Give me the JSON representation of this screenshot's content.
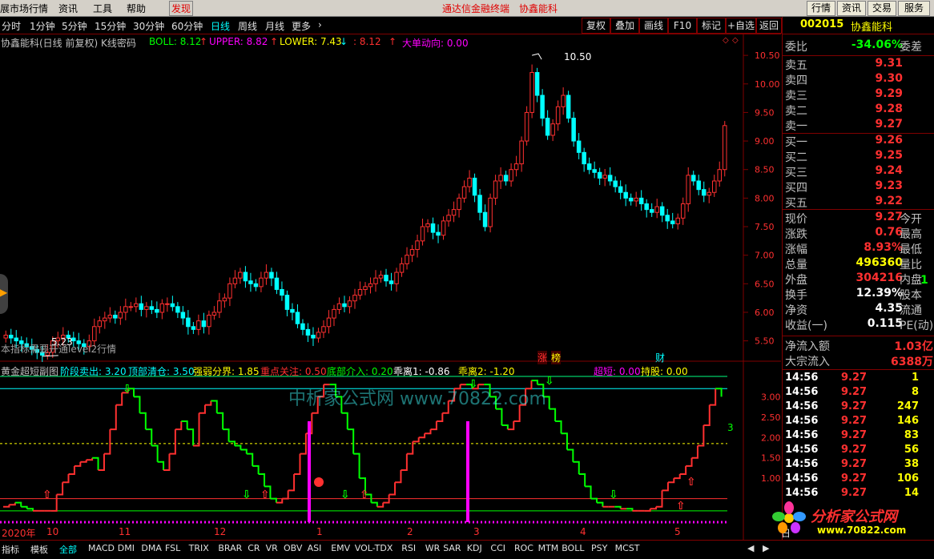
{
  "menu": {
    "items": [
      "展市场行情",
      "资讯",
      "工具",
      "帮助"
    ],
    "discover": "发现",
    "center_title": "通达信金融终端",
    "center_stock": "协鑫能科",
    "right_buttons": [
      "行情",
      "资讯",
      "交易",
      "服务"
    ]
  },
  "periods": [
    "分时",
    "1分钟",
    "5分钟",
    "15分钟",
    "30分钟",
    "60分钟",
    "日线",
    "周线",
    "月线",
    "更多"
  ],
  "active_period": "日线",
  "toolbar_buttons": [
    "复权",
    "叠加",
    "画线",
    "F10",
    "标记",
    "+自选",
    "返回"
  ],
  "main_legend": {
    "title": "协鑫能科(日线 前复权) K线密码",
    "boll": "BOLL: 8.12",
    "upper": "UPPER: 8.82",
    "lower": "LOWER: 7.43",
    "mid": ": 8.12",
    "dadan": "大单动向: 0.00"
  },
  "main_axis": [
    "10.50",
    "10.00",
    "9.50",
    "9.00",
    "8.50",
    "8.00",
    "7.50",
    "7.00",
    "6.50",
    "6.00",
    "5.50"
  ],
  "main_notes": {
    "high_label": "10.50",
    "low_label": "5.23",
    "level2_note": "本指标需要开通level2行情",
    "tag_zhang": "涨",
    "tag_bang": "榜",
    "tag_cai": "财"
  },
  "sub_legend": {
    "title": "黄金超短副图",
    "items": [
      {
        "text": "阶段卖出: 3.20",
        "color": "#00ffff"
      },
      {
        "text": "顶部清仓: 3.50",
        "color": "#00ffff"
      },
      {
        "text": "强弱分界: 1.85",
        "color": "#ffff00"
      },
      {
        "text": "重点关注: 0.50",
        "color": "#ff3030"
      },
      {
        "text": "底部介入: 0.20",
        "color": "#00ff00"
      },
      {
        "text": "乖离1: -0.86",
        "color": "#ffffff"
      },
      {
        "text": "乖离2: -1.20",
        "color": "#ffff00"
      },
      {
        "text": "超短: 0.00",
        "color": "#ff00ff"
      },
      {
        "text": "持股: 0.00",
        "color": "#ffff00"
      }
    ]
  },
  "sub_axis": [
    "3.00",
    "2.50",
    "2.00",
    "1.50",
    "1.00"
  ],
  "sub_value_label": "3",
  "watermark": "中析家公式网 www.70822.com",
  "x_axis": [
    "2020年",
    "10",
    "11",
    "12",
    "1",
    "2",
    "3",
    "4",
    "5"
  ],
  "quote": {
    "code": "002015",
    "name": "协鑫能科",
    "weibi_label": "委比",
    "weibi": "-34.06%",
    "weicha_label": "委差",
    "sell": [
      {
        "label": "卖五",
        "price": "9.31"
      },
      {
        "label": "卖四",
        "price": "9.30"
      },
      {
        "label": "卖三",
        "price": "9.29"
      },
      {
        "label": "卖二",
        "price": "9.28"
      },
      {
        "label": "卖一",
        "price": "9.27"
      }
    ],
    "buy": [
      {
        "label": "买一",
        "price": "9.26"
      },
      {
        "label": "买二",
        "price": "9.25"
      },
      {
        "label": "买三",
        "price": "9.24"
      },
      {
        "label": "买四",
        "price": "9.23"
      },
      {
        "label": "买五",
        "price": "9.22"
      }
    ],
    "stats": [
      {
        "label": "现价",
        "value": "9.27",
        "label2": "今开",
        "color": "#ff3030"
      },
      {
        "label": "涨跌",
        "value": "0.76",
        "label2": "最高",
        "color": "#ff3030"
      },
      {
        "label": "涨幅",
        "value": "8.93%",
        "label2": "最低",
        "color": "#ff3030"
      },
      {
        "label": "总量",
        "value": "496360",
        "label2": "量比",
        "color": "#ffff00"
      },
      {
        "label": "外盘",
        "value": "304216",
        "label2": "内盘",
        "color": "#ff3030"
      },
      {
        "label": "换手",
        "value": "12.39%",
        "label2": "股本",
        "color": "#ffffff"
      },
      {
        "label": "净资",
        "value": "4.35",
        "label2": "流通",
        "color": "#ffffff"
      },
      {
        "label": "收益(一)",
        "value": "0.115",
        "label2": "PE(动)",
        "color": "#ffffff"
      }
    ],
    "neipan_partial": "1",
    "net_inflow_label": "净流入额",
    "net_inflow": "1.03亿",
    "big_inflow_label": "大宗流入",
    "big_inflow": "6388万",
    "ticks": [
      {
        "time": "14:56",
        "price": "9.27",
        "vol": "1"
      },
      {
        "time": "14:56",
        "price": "9.27",
        "vol": "8"
      },
      {
        "time": "14:56",
        "price": "9.27",
        "vol": "247"
      },
      {
        "time": "14:56",
        "price": "9.27",
        "vol": "146"
      },
      {
        "time": "14:56",
        "price": "9.27",
        "vol": "83"
      },
      {
        "time": "14:56",
        "price": "9.27",
        "vol": "56"
      },
      {
        "time": "14:56",
        "price": "9.27",
        "vol": "38"
      },
      {
        "time": "14:56",
        "price": "9.27",
        "vol": "106"
      },
      {
        "time": "14:56",
        "price": "9.27",
        "vol": "14"
      }
    ],
    "day_tab": "日"
  },
  "bottom_tabs": [
    "指标",
    "模板",
    "全部",
    "MACD",
    "DMI",
    "DMA",
    "FSL",
    "TRIX",
    "BRAR",
    "CR",
    "VR",
    "OBV",
    "ASI",
    "EMV",
    "VOL-TDX",
    "RSI",
    "WR",
    "SAR",
    "KDJ",
    "CCI",
    "ROC",
    "MTM",
    "BOLL",
    "PSY",
    "MCST"
  ],
  "active_tab": "全部",
  "logo": {
    "line1": "分析家公式网",
    "line2": "www.70822.com"
  },
  "chart_data": {
    "type": "candlestick",
    "ylim": [
      5.2,
      10.6
    ],
    "high_marker": 10.5,
    "low_marker": 5.23,
    "closes": [
      5.6,
      5.55,
      5.5,
      5.45,
      5.4,
      5.35,
      5.3,
      5.25,
      5.3,
      5.5,
      5.55,
      5.6,
      5.55,
      5.5,
      5.45,
      5.4,
      5.5,
      5.75,
      5.85,
      5.9,
      5.95,
      5.9,
      6.0,
      6.1,
      6.1,
      6.15,
      6.05,
      6.1,
      6.05,
      6.0,
      6.15,
      6.15,
      6.1,
      6.0,
      5.9,
      5.75,
      5.7,
      5.85,
      5.75,
      5.95,
      6.0,
      6.2,
      6.25,
      6.5,
      6.6,
      6.7,
      6.55,
      6.5,
      6.45,
      6.6,
      6.7,
      6.6,
      6.4,
      6.3,
      6.05,
      6.0,
      5.8,
      5.7,
      5.6,
      5.55,
      5.65,
      5.75,
      5.9,
      6.05,
      6.15,
      6.1,
      6.2,
      6.3,
      6.4,
      6.45,
      6.5,
      6.6,
      6.65,
      6.55,
      6.5,
      6.7,
      6.85,
      7.0,
      7.1,
      7.25,
      7.5,
      7.55,
      7.4,
      7.35,
      7.6,
      7.7,
      7.8,
      8.0,
      8.2,
      8.35,
      8.05,
      7.75,
      7.5,
      8.0,
      8.3,
      8.4,
      8.3,
      8.5,
      8.6,
      9.0,
      9.5,
      10.2,
      9.8,
      9.4,
      9.1,
      9.3,
      9.6,
      9.8,
      9.4,
      9.0,
      8.8,
      8.6,
      8.5,
      8.45,
      8.35,
      8.4,
      8.3,
      8.2,
      8.1,
      8.0,
      7.95,
      8.0,
      7.9,
      7.8,
      7.75,
      7.85,
      7.7,
      7.6,
      7.55,
      7.65,
      7.9,
      8.4,
      8.3,
      8.15,
      8.05,
      8.1,
      8.3,
      8.5,
      9.27
    ],
    "sub": {
      "type": "line",
      "ylim": [
        0,
        3.5
      ],
      "levels": {
        "顶部清仓": 3.5,
        "阶段卖出": 3.2,
        "强弱分界": 1.85,
        "重点关注": 0.5,
        "底部介入": 0.2
      },
      "values": [
        0.3,
        0.35,
        0.4,
        0.3,
        0.25,
        0.2,
        0.2,
        0.2,
        0.2,
        0.6,
        0.9,
        1.1,
        1.3,
        1.4,
        1.45,
        1.5,
        1.2,
        1.6,
        2.2,
        2.8,
        3.1,
        3.2,
        3.0,
        2.6,
        2.2,
        1.8,
        1.4,
        1.2,
        1.6,
        2.2,
        2.4,
        2.2,
        1.8,
        2.6,
        2.8,
        2.9,
        2.6,
        2.2,
        1.9,
        1.8,
        1.7,
        1.6,
        1.3,
        1.1,
        0.8,
        0.5,
        0.4,
        0.5,
        0.7,
        1.1,
        1.6,
        2.1,
        2.6,
        3.0,
        3.3,
        3.3,
        3.0,
        2.6,
        2.2,
        1.6,
        1.0,
        0.6,
        0.4,
        0.3,
        0.4,
        0.6,
        0.9,
        1.2,
        1.6,
        1.9,
        2.0,
        2.1,
        2.2,
        2.4,
        2.6,
        2.9,
        3.2,
        3.3,
        3.3,
        3.2,
        3.3,
        3.3,
        3.0,
        2.7,
        2.3,
        2.2,
        2.4,
        2.8,
        3.2,
        3.4,
        3.3,
        3.0,
        2.7,
        2.4,
        2.1,
        1.7,
        1.4,
        1.1,
        0.8,
        0.5,
        0.4,
        0.3,
        0.3,
        0.3,
        0.25,
        0.25,
        0.2,
        0.2,
        0.2,
        0.25,
        0.3,
        0.7,
        0.9,
        1.0,
        1.1,
        1.3,
        1.5,
        1.8,
        2.3,
        2.8,
        3.2,
        3.0
      ]
    }
  }
}
